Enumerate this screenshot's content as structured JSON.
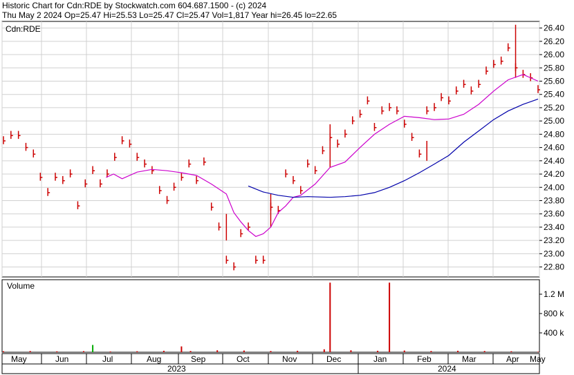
{
  "header": {
    "line1": "Historic Chart for Cdn:RDE by Stockwatch.com 604.687.1500 - (c) 2024",
    "line2": "Thu May  2 2024   Op=25.47  Hi=25.53  Lo=25.47  Cl=25.47  Vol=1,817  Year hi=26.45  lo=22.65"
  },
  "chart_data": [
    {
      "type": "ohlc",
      "symbol_label": "Cdn:RDE",
      "ylim": [
        22.65,
        26.5
      ],
      "y_ticks": [
        "26.40",
        "26.20",
        "26.00",
        "25.80",
        "25.60",
        "25.40",
        "25.20",
        "25.00",
        "24.80",
        "24.60",
        "24.40",
        "24.20",
        "24.00",
        "23.80",
        "23.60",
        "23.40",
        "23.20",
        "23.00",
        "22.80"
      ],
      "grid": true,
      "bar_color": "#cc0000",
      "series": [
        {
          "color": "#cc00cc",
          "points": [
            [
              0.192,
              24.15
            ],
            [
              0.206,
              24.2
            ],
            [
              0.222,
              24.13
            ],
            [
              0.25,
              24.23
            ],
            [
              0.278,
              24.27
            ],
            [
              0.306,
              24.25
            ],
            [
              0.333,
              24.22
            ],
            [
              0.361,
              24.18
            ],
            [
              0.389,
              24.05
            ],
            [
              0.417,
              23.9
            ],
            [
              0.431,
              23.62
            ],
            [
              0.444,
              23.48
            ],
            [
              0.458,
              23.35
            ],
            [
              0.472,
              23.26
            ],
            [
              0.486,
              23.3
            ],
            [
              0.5,
              23.4
            ],
            [
              0.514,
              23.62
            ],
            [
              0.528,
              23.72
            ],
            [
              0.542,
              23.85
            ],
            [
              0.556,
              23.88
            ],
            [
              0.583,
              24.05
            ],
            [
              0.611,
              24.3
            ],
            [
              0.639,
              24.38
            ],
            [
              0.667,
              24.6
            ],
            [
              0.694,
              24.8
            ],
            [
              0.722,
              24.95
            ],
            [
              0.75,
              25.07
            ],
            [
              0.778,
              25.05
            ],
            [
              0.806,
              25.02
            ],
            [
              0.833,
              25.03
            ],
            [
              0.861,
              25.1
            ],
            [
              0.889,
              25.25
            ],
            [
              0.917,
              25.45
            ],
            [
              0.944,
              25.62
            ],
            [
              0.972,
              25.7
            ],
            [
              1.0,
              25.6
            ]
          ]
        },
        {
          "color": "#0000aa",
          "points": [
            [
              0.458,
              24.02
            ],
            [
              0.486,
              23.93
            ],
            [
              0.514,
              23.88
            ],
            [
              0.542,
              23.85
            ],
            [
              0.569,
              23.86
            ],
            [
              0.611,
              23.85
            ],
            [
              0.639,
              23.86
            ],
            [
              0.667,
              23.88
            ],
            [
              0.694,
              23.92
            ],
            [
              0.722,
              24.0
            ],
            [
              0.75,
              24.1
            ],
            [
              0.778,
              24.22
            ],
            [
              0.806,
              24.35
            ],
            [
              0.833,
              24.48
            ],
            [
              0.861,
              24.68
            ],
            [
              0.889,
              24.85
            ],
            [
              0.917,
              25.02
            ],
            [
              0.944,
              25.15
            ],
            [
              0.972,
              25.25
            ],
            [
              1.0,
              25.33
            ]
          ]
        }
      ],
      "ohlc_points": [
        [
          0.0,
          24.7
        ],
        [
          0.014,
          24.78
        ],
        [
          0.028,
          24.78
        ],
        [
          0.042,
          24.6
        ],
        [
          0.056,
          24.5
        ],
        [
          0.069,
          24.15
        ],
        [
          0.083,
          23.92
        ],
        [
          0.097,
          24.15
        ],
        [
          0.111,
          24.1
        ],
        [
          0.125,
          24.2
        ],
        [
          0.139,
          23.72
        ],
        [
          0.153,
          24.05
        ],
        [
          0.167,
          24.25
        ],
        [
          0.181,
          24.05
        ],
        [
          0.194,
          24.2
        ],
        [
          0.208,
          24.45
        ],
        [
          0.222,
          24.7
        ],
        [
          0.236,
          24.65
        ],
        [
          0.25,
          24.45
        ],
        [
          0.264,
          24.35
        ],
        [
          0.278,
          24.25
        ],
        [
          0.292,
          23.95
        ],
        [
          0.306,
          23.8
        ],
        [
          0.319,
          24.0
        ],
        [
          0.333,
          24.15
        ],
        [
          0.347,
          24.35
        ],
        [
          0.361,
          24.1
        ],
        [
          0.375,
          24.38
        ],
        [
          0.389,
          23.7
        ],
        [
          0.403,
          23.4
        ],
        [
          0.417,
          22.9
        ],
        [
          0.431,
          22.8
        ],
        [
          0.444,
          23.3
        ],
        [
          0.458,
          23.4
        ],
        [
          0.472,
          22.9
        ],
        [
          0.486,
          22.9
        ],
        [
          0.5,
          23.7
        ],
        [
          0.514,
          23.65
        ],
        [
          0.528,
          24.2
        ],
        [
          0.542,
          24.1
        ],
        [
          0.556,
          23.95
        ],
        [
          0.569,
          24.35
        ],
        [
          0.583,
          24.25
        ],
        [
          0.597,
          24.55
        ],
        [
          0.611,
          24.75
        ],
        [
          0.625,
          24.65
        ],
        [
          0.639,
          24.8
        ],
        [
          0.653,
          25.0
        ],
        [
          0.667,
          25.1
        ],
        [
          0.681,
          25.3
        ],
        [
          0.694,
          24.9
        ],
        [
          0.708,
          25.15
        ],
        [
          0.722,
          25.2
        ],
        [
          0.736,
          25.15
        ],
        [
          0.75,
          24.95
        ],
        [
          0.764,
          24.75
        ],
        [
          0.778,
          24.5
        ],
        [
          0.792,
          25.15
        ],
        [
          0.806,
          25.2
        ],
        [
          0.819,
          25.35
        ],
        [
          0.833,
          25.3
        ],
        [
          0.847,
          25.45
        ],
        [
          0.861,
          25.55
        ],
        [
          0.875,
          25.45
        ],
        [
          0.889,
          25.55
        ],
        [
          0.903,
          25.75
        ],
        [
          0.917,
          25.85
        ],
        [
          0.931,
          25.9
        ],
        [
          0.944,
          26.1
        ],
        [
          0.958,
          25.8
        ],
        [
          0.972,
          25.7
        ],
        [
          0.986,
          25.65
        ],
        [
          1.0,
          25.47
        ]
      ]
    },
    {
      "type": "bar",
      "title": "Volume",
      "y_ticks": [
        "1.2 M",
        "800 k",
        "400 k"
      ],
      "y_tick_values": [
        1200000,
        800000,
        400000
      ],
      "ylim": [
        0,
        1500000
      ],
      "colors": {
        "up": "#00aa00",
        "down": "#cc0000"
      },
      "bars": [
        [
          0.167,
          150000,
          "up"
        ],
        [
          0.333,
          120000,
          "down"
        ],
        [
          0.611,
          1440000,
          "down"
        ],
        [
          0.722,
          1440000,
          "down"
        ],
        [
          0.0,
          20000,
          "down"
        ],
        [
          0.05,
          25000,
          "down"
        ],
        [
          0.1,
          18000,
          "down"
        ],
        [
          0.15,
          22000,
          "down"
        ],
        [
          0.2,
          15000,
          "down"
        ],
        [
          0.25,
          20000,
          "down"
        ],
        [
          0.3,
          30000,
          "down"
        ],
        [
          0.35,
          25000,
          "down"
        ],
        [
          0.4,
          40000,
          "down"
        ],
        [
          0.45,
          35000,
          "down"
        ],
        [
          0.5,
          25000,
          "down"
        ],
        [
          0.55,
          30000,
          "down"
        ],
        [
          0.6,
          60000,
          "down"
        ],
        [
          0.65,
          40000,
          "down"
        ],
        [
          0.7,
          30000,
          "down"
        ],
        [
          0.75,
          35000,
          "down"
        ],
        [
          0.8,
          25000,
          "down"
        ],
        [
          0.85,
          30000,
          "down"
        ],
        [
          0.9,
          25000,
          "down"
        ],
        [
          0.95,
          20000,
          "down"
        ],
        [
          1.0,
          10000,
          "down"
        ]
      ]
    }
  ],
  "x_axis": {
    "months": [
      "May",
      "Jun",
      "Jul",
      "Aug",
      "Sep",
      "Oct",
      "Nov",
      "Dec",
      "Jan",
      "Feb",
      "Mar",
      "Apr",
      "May"
    ],
    "years": [
      "2023",
      "2024"
    ]
  }
}
